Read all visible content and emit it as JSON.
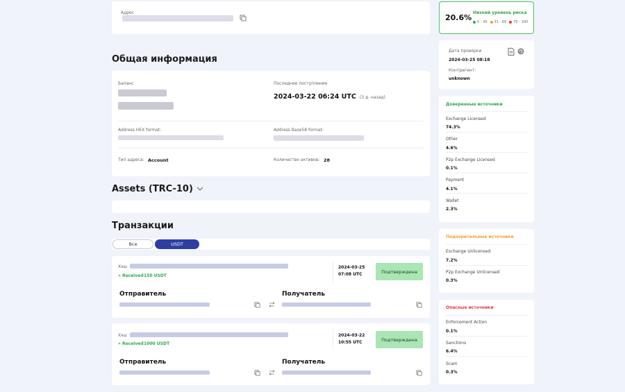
{
  "address_card": {
    "label": "Адрес"
  },
  "general": {
    "title": "Общая информация",
    "balance_label": "Баланс",
    "last_receipt_label": "Последнее поступление",
    "last_receipt_value": "2024-03-22 06:24 UTC",
    "last_receipt_ago": "(3 д. назад)",
    "hex_label": "Address HEX format:",
    "base58_label": "Address Base58 format:",
    "type_label": "Тип адреса:",
    "type_value": "Account",
    "assets_count_label": "Количество активов:",
    "assets_count_value": "28"
  },
  "assets": {
    "title": "Assets (TRC-10)"
  },
  "transactions": {
    "title": "Транзакции",
    "tabs": [
      {
        "label": "Все",
        "active": false
      },
      {
        "label": "USDT",
        "active": true
      }
    ],
    "items": [
      {
        "hash_label": "Хэш",
        "received": "» Received",
        "amount": "150 USDT",
        "date": "2024-03-25",
        "time": "07:08 UTC",
        "status": "Подтверждена",
        "sender_label": "Отправитель",
        "recipient_label": "Получатель"
      },
      {
        "hash_label": "Хэш",
        "received": "» Received",
        "amount": "1000 USDT",
        "date": "2024-03-22",
        "time": "10:55 UTC",
        "status": "Подтверждена",
        "sender_label": "Отправитель",
        "recipient_label": "Получатель"
      }
    ]
  },
  "risk": {
    "score": "20.6%",
    "level": "Низкий уровень риска",
    "legend": [
      {
        "label": "0 - 30",
        "color": "#2fa84f"
      },
      {
        "label": "31 - 69",
        "color": "#f0a030"
      },
      {
        "label": "70 - 100",
        "color": "#e53935"
      }
    ]
  },
  "check": {
    "date_label": "Дата проверки",
    "date_value": "2024-03-25 08:18",
    "counterparty_label": "Контрагент:",
    "counterparty_value": "unknown"
  },
  "trusted": {
    "title": "Доверенные источники",
    "color": "#2fa84f",
    "items": [
      {
        "label": "Exchange Licensed",
        "value": "74.3%"
      },
      {
        "label": "Other",
        "value": "4.6%"
      },
      {
        "label": "P2p Exchange Licensed",
        "value": "0.1%"
      },
      {
        "label": "Payment",
        "value": "4.1%"
      },
      {
        "label": "Wallet",
        "value": "2.3%"
      }
    ]
  },
  "suspicious": {
    "title": "Подозрительные источники",
    "color": "#f0a030",
    "items": [
      {
        "label": "Exchange Unlicensed",
        "value": "7.2%"
      },
      {
        "label": "P2p Exchange Unlicensed",
        "value": "0.3%"
      }
    ]
  },
  "dangerous": {
    "title": "Опасные источники",
    "color": "#e53935",
    "items": [
      {
        "label": "Enforcement Action",
        "value": "0.1%"
      },
      {
        "label": "Sanctions",
        "value": "6.4%"
      },
      {
        "label": "Scam",
        "value": "0.3%"
      }
    ]
  }
}
